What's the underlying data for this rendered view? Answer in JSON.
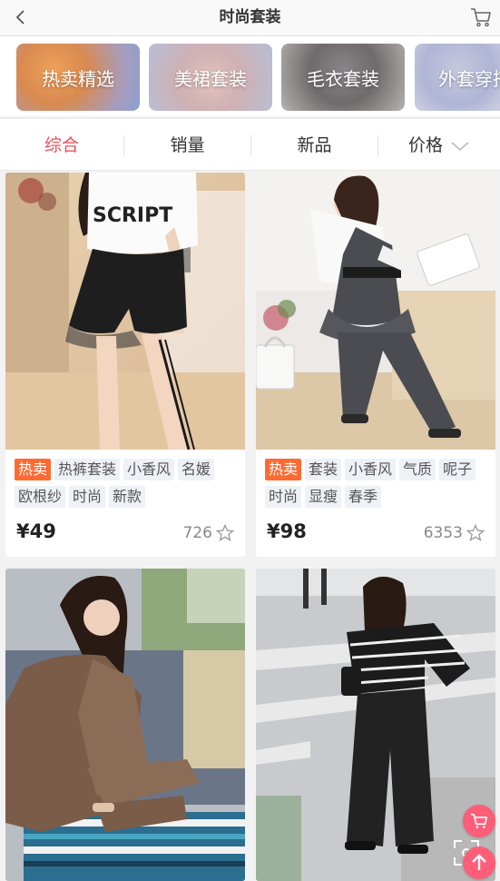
{
  "header": {
    "title": "时尚套装",
    "back_icon": "back-chevron-icon",
    "cart_icon": "shopping-cart-icon"
  },
  "categories": [
    {
      "label": "热卖精选"
    },
    {
      "label": "美裙套装"
    },
    {
      "label": "毛衣套装"
    },
    {
      "label": "外套穿搭"
    }
  ],
  "sort": {
    "items": [
      {
        "label": "综合"
      },
      {
        "label": "销量"
      },
      {
        "label": "新品"
      },
      {
        "label": "价格"
      }
    ],
    "active_color": "#e8505b"
  },
  "products": [
    {
      "hot_label": "热卖",
      "tags_row1": [
        "热裤套装",
        "小香风",
        "名媛"
      ],
      "tags_row2": [
        "欧根纱",
        "时尚",
        "新款"
      ],
      "price": "¥49",
      "sales": "726",
      "photo_text": "SCRIPT"
    },
    {
      "hot_label": "热卖",
      "tags_row1": [
        "套装",
        "小香风",
        "气质",
        "呢子"
      ],
      "tags_row2": [
        "时尚",
        "显瘦",
        "春季"
      ],
      "price": "¥98",
      "sales": "6353"
    },
    {},
    {}
  ],
  "colors": {
    "accent": "#e8505b",
    "hot_tag": "#ff6a33",
    "fab": "#ff5e78"
  }
}
